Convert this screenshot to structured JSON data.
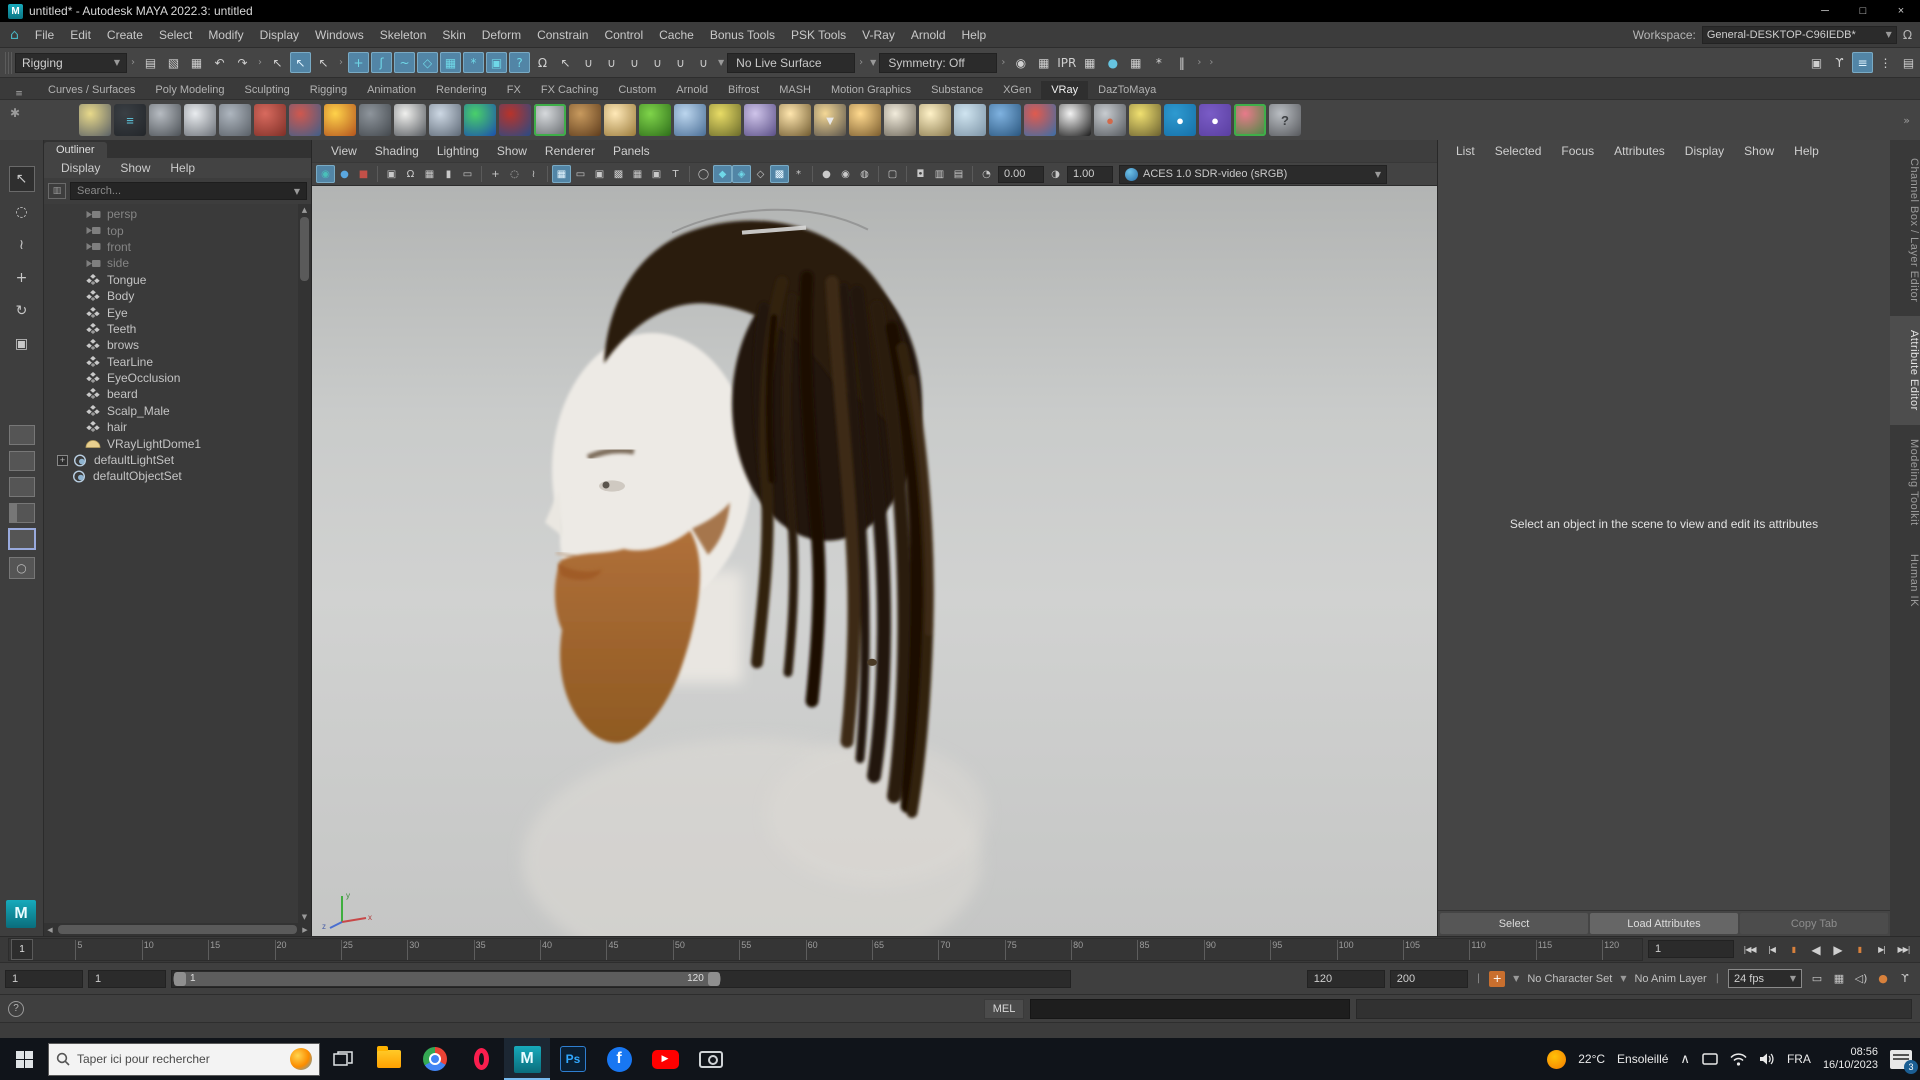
{
  "titlebar": {
    "title": "untitled* - Autodesk MAYA 2022.3: untitled",
    "minimize": "─",
    "maximize": "□",
    "close": "×"
  },
  "menubar": {
    "items": [
      "File",
      "Edit",
      "Create",
      "Select",
      "Modify",
      "Display",
      "Windows",
      "Skeleton",
      "Skin",
      "Deform",
      "Constrain",
      "Control",
      "Cache",
      "Bonus Tools",
      "PSK Tools",
      "V-Ray",
      "Arnold",
      "Help"
    ],
    "workspace_label": "Workspace:",
    "workspace_value": "General-DESKTOP-C96IEDB*"
  },
  "statusline": {
    "mode": "Rigging",
    "live_surface": "No Live Surface",
    "symmetry": "Symmetry: Off",
    "file_icons": [
      {
        "n": "new-scene",
        "g": "▤"
      },
      {
        "n": "open-scene",
        "g": "▧"
      },
      {
        "n": "save-scene",
        "g": "▦"
      },
      {
        "n": "undo",
        "g": "↶"
      },
      {
        "n": "redo",
        "g": "↷"
      }
    ],
    "select_icons": [
      {
        "n": "select-by-hierarchy",
        "g": "↖"
      },
      {
        "n": "select-by-object",
        "g": "↖",
        "a": true
      },
      {
        "n": "select-by-component",
        "g": "↖"
      }
    ],
    "mask_icons": [
      {
        "n": "select-handles",
        "g": "+",
        "a": true
      },
      {
        "n": "select-joints",
        "g": "ʃ",
        "a": true
      },
      {
        "n": "select-curves",
        "g": "~",
        "a": true
      },
      {
        "n": "select-surfaces",
        "g": "◇",
        "a": true
      },
      {
        "n": "select-deformers",
        "g": "▦",
        "a": true
      },
      {
        "n": "select-dynamics",
        "g": "*",
        "a": true
      },
      {
        "n": "select-rendering",
        "g": "▣",
        "a": true
      },
      {
        "n": "select-misc",
        "g": "?",
        "a": true
      }
    ],
    "lock_icons": [
      {
        "n": "lock-selection",
        "g": "Ω"
      },
      {
        "n": "highlight-selection",
        "g": "↖"
      }
    ],
    "snap_icons": [
      {
        "n": "snap-to-grids",
        "g": "∪"
      },
      {
        "n": "snap-to-curves",
        "g": "∪"
      },
      {
        "n": "snap-to-points",
        "g": "∪"
      },
      {
        "n": "snap-to-projected-center",
        "g": "∪"
      },
      {
        "n": "snap-to-view-planes",
        "g": "∪"
      },
      {
        "n": "make-object-live",
        "g": "∪"
      }
    ],
    "render_icons": [
      {
        "n": "open-render-view",
        "g": "◉"
      },
      {
        "n": "render-current-frame",
        "g": "▦"
      },
      {
        "n": "ipr-render",
        "g": "IPR"
      },
      {
        "n": "render-settings",
        "g": "▦"
      },
      {
        "n": "hypershade",
        "g": "●",
        "c": "#66c4e0"
      },
      {
        "n": "render-setup",
        "g": "▦"
      },
      {
        "n": "light-editor",
        "g": "*"
      },
      {
        "n": "pause-viewport",
        "g": "‖"
      }
    ],
    "right_icons": [
      {
        "n": "modeling-toolkit",
        "g": "▣"
      },
      {
        "n": "human-ik",
        "g": "ϒ"
      },
      {
        "n": "attribute-editor",
        "g": "≡",
        "a": true
      },
      {
        "n": "tool-settings",
        "g": "⋮"
      },
      {
        "n": "channel-box",
        "g": "▤"
      }
    ]
  },
  "shelf": {
    "tabs": [
      "Curves / Surfaces",
      "Poly Modeling",
      "Sculpting",
      "Rigging",
      "Animation",
      "Rendering",
      "FX",
      "FX Caching",
      "Custom",
      "Arnold",
      "Bifrost",
      "MASH",
      "Motion Graphics",
      "Substance",
      "XGen",
      "VRay",
      "DazToMaya"
    ],
    "active_tab": "VRay",
    "overflow": "»",
    "icons": [
      {
        "n": "vray-proxy-export",
        "b1": "#cfd4d9",
        "b2": "#4d5archive256"
      },
      {
        "n": "vray-proxy-import",
        "b1": "#e8d98a",
        "b2": "#5a6066"
      },
      {
        "n": "vray-scene-manager",
        "b1": "#3a3f44",
        "b2": "#23262a",
        "g": "≡",
        "gc": "#5ec8e0"
      },
      {
        "n": "vray-plugin",
        "b1": "#b7bcc2",
        "b2": "#4c5156"
      },
      {
        "n": "vray-notes",
        "b1": "#e9ecef",
        "b2": "#6b7077"
      },
      {
        "n": "vray-blend-material",
        "b1": "#aeb6bf",
        "b2": "#595f66"
      },
      {
        "n": "vray-physical-camera",
        "b1": "#d86a5e",
        "b2": "#7e2f27"
      },
      {
        "n": "vray-displacement",
        "b1": "#d0584e",
        "b2": "#3e5f8a"
      },
      {
        "n": "vray-fire",
        "b1": "#ffd24a",
        "b2": "#b3541e"
      },
      {
        "n": "vray-volume-grid",
        "b1": "#8e959c",
        "b2": "#43484d"
      },
      {
        "n": "vray-paper",
        "b1": "#f0f0ee",
        "b2": "#55595e"
      },
      {
        "n": "vray-cone-sphere",
        "b1": "#cdd8e4",
        "b2": "#5d6875"
      },
      {
        "n": "vray-heatmap",
        "b1": "#49d06a",
        "b2": "#1c4fae"
      },
      {
        "n": "vray-earth",
        "b1": "#b8332a",
        "b2": "#274b86"
      },
      {
        "n": "vray-sphere-selected",
        "b1": "#d6d9dc",
        "b2": "#62666a",
        "frame": "#3fae49"
      },
      {
        "n": "vray-wood-texture",
        "b1": "#c89a5e",
        "b2": "#5e3c1c"
      },
      {
        "n": "vray-glow-sphere",
        "b1": "#ffe9b8",
        "b2": "#9a7a3a"
      },
      {
        "n": "vray-grass",
        "b1": "#7fd44a",
        "b2": "#2e6e1a"
      },
      {
        "n": "vray-flakes",
        "b1": "#bcd6ee",
        "b2": "#4a6e96"
      },
      {
        "n": "vray-curve-tool",
        "b1": "#e8dc66",
        "b2": "#6a6a2a"
      },
      {
        "n": "vray-sphere-light-purple",
        "b1": "#cfc4ea",
        "b2": "#5a4f86"
      },
      {
        "n": "vray-dome-light",
        "b1": "#ffe6ae",
        "b2": "#6f5a30"
      },
      {
        "n": "vray-rect-light",
        "b1": "#f4d896",
        "b2": "#58524a",
        "g": "▼",
        "gc": "#e8e8e8"
      },
      {
        "n": "vray-sphere-light",
        "b1": "#ffd98e",
        "b2": "#7a5c2e"
      },
      {
        "n": "vray-spot-light",
        "b1": "#f2ecdc",
        "b2": "#6c665a"
      },
      {
        "n": "vray-sun-light",
        "b1": "#fff2c8",
        "b2": "#8a7a4e"
      },
      {
        "n": "vray-plane",
        "b1": "#cfe4f0",
        "b2": "#7d94a6"
      },
      {
        "n": "vray-material-sphere",
        "b1": "#7fb2e0",
        "b2": "#2a567e"
      },
      {
        "n": "vray-multi-material",
        "b1": "#e05a4e",
        "b2": "#3a6ea8"
      },
      {
        "n": "vray-checker",
        "b1": "#f2f2f2",
        "b2": "#1a1a1a"
      },
      {
        "n": "vray-frame-buffer",
        "b1": "#c8ccd0",
        "b2": "#55595e",
        "g": "●",
        "gc": "#d2694a"
      },
      {
        "n": "vray-light-lister",
        "b1": "#f0e070",
        "b2": "#6a6030"
      },
      {
        "n": "vray-cloud",
        "b1": "#2e9ad0",
        "b2": "#1670a8",
        "g": "●",
        "gc": "#ffffff"
      },
      {
        "n": "vray-color-palette",
        "b1": "#7a5cc6",
        "b2": "#5a3fa0",
        "g": "●",
        "gc": "#ffffff"
      },
      {
        "n": "vray-balloons",
        "b1": "#e87a8a",
        "b2": "#3f8a3f",
        "frame": "#3fae49"
      },
      {
        "n": "vray-help",
        "b1": "#b9bdc2",
        "b2": "#56585c",
        "g": "?",
        "gc": "#3e4144"
      }
    ]
  },
  "toolbox": {
    "tools": [
      {
        "n": "select-tool",
        "g": "↖",
        "a": true
      },
      {
        "n": "lasso-tool",
        "g": "◌"
      },
      {
        "n": "paint-select-tool",
        "g": "≀"
      },
      {
        "n": "move-tool",
        "g": "+"
      },
      {
        "n": "rotate-tool",
        "g": "↻"
      },
      {
        "n": "scale-tool",
        "g": "▣"
      }
    ],
    "layouts": [
      {
        "n": "layout-single",
        "v": "a"
      },
      {
        "n": "layout-two-panes",
        "v": "b"
      },
      {
        "n": "layout-four-view",
        "v": "c"
      },
      {
        "n": "layout-outliner-persp",
        "v": "d"
      },
      {
        "n": "layout-persp-graph",
        "v": "b",
        "a": true
      }
    ],
    "magnifier": {
      "n": "zoom-layout",
      "g": "○"
    }
  },
  "outliner": {
    "title": "Outliner",
    "menus": [
      "Display",
      "Show",
      "Help"
    ],
    "search_placeholder": "Search...",
    "items": [
      {
        "label": "persp",
        "icon": "camera",
        "muted": true
      },
      {
        "label": "top",
        "icon": "camera",
        "muted": true
      },
      {
        "label": "front",
        "icon": "camera",
        "muted": true
      },
      {
        "label": "side",
        "icon": "camera",
        "muted": true
      },
      {
        "label": "Tongue",
        "icon": "mesh"
      },
      {
        "label": "Body",
        "icon": "mesh"
      },
      {
        "label": "Eye",
        "icon": "mesh"
      },
      {
        "label": "Teeth",
        "icon": "mesh"
      },
      {
        "label": "brows",
        "icon": "mesh"
      },
      {
        "label": "TearLine",
        "icon": "mesh"
      },
      {
        "label": "EyeOcclusion",
        "icon": "mesh"
      },
      {
        "label": "beard",
        "icon": "mesh"
      },
      {
        "label": "Scalp_Male",
        "icon": "mesh"
      },
      {
        "label": "hair",
        "icon": "mesh"
      },
      {
        "label": "VRayLightDome1",
        "icon": "dome-light"
      },
      {
        "label": "defaultLightSet",
        "icon": "set",
        "expandable": true
      },
      {
        "label": "defaultObjectSet",
        "icon": "set"
      }
    ]
  },
  "viewport": {
    "menus": [
      "View",
      "Shading",
      "Lighting",
      "Show",
      "Renderer",
      "Panels"
    ],
    "toolbar_icons": [
      {
        "n": "vray-vfb-toggle",
        "g": "◉",
        "a": true,
        "c": "#49c0b9"
      },
      {
        "n": "vray-ipr-start",
        "g": "●",
        "c": "#5aa7e0"
      },
      {
        "n": "vray-ipr-stop",
        "g": "■",
        "c": "#c25048"
      },
      {
        "d": 1
      },
      {
        "n": "select-camera",
        "g": "▣"
      },
      {
        "n": "lock-camera",
        "g": "Ω"
      },
      {
        "n": "camera-attributes",
        "g": "▦"
      },
      {
        "n": "bookmark-view",
        "g": "▮"
      },
      {
        "n": "image-plane",
        "g": "▭"
      },
      {
        "d": 1
      },
      {
        "n": "2d-pan-zoom",
        "g": "+"
      },
      {
        "n": "pick-matte",
        "g": "◌"
      },
      {
        "n": "greasepencil",
        "g": "≀"
      },
      {
        "d": 1
      },
      {
        "n": "grid-toggle",
        "g": "▦",
        "a": true
      },
      {
        "n": "film-gate",
        "g": "▭"
      },
      {
        "n": "resolution-gate",
        "g": "▣"
      },
      {
        "n": "gate-mask",
        "g": "▩"
      },
      {
        "n": "field-chart",
        "g": "▦"
      },
      {
        "n": "safe-action",
        "g": "▣"
      },
      {
        "n": "safe-title",
        "g": "T"
      },
      {
        "d": 1
      },
      {
        "n": "wireframe",
        "g": "◯"
      },
      {
        "n": "smooth-shade",
        "g": "◆",
        "a": true,
        "c": "#6fd8e8"
      },
      {
        "n": "textured",
        "g": "◈",
        "a": true,
        "c": "#6fd8e8"
      },
      {
        "n": "wire-on-shaded",
        "g": "◇"
      },
      {
        "n": "xray",
        "g": "▩",
        "a": true
      },
      {
        "n": "lighting-all",
        "g": "*"
      },
      {
        "d": 1
      },
      {
        "n": "shadows",
        "g": "●"
      },
      {
        "n": "ambient-occlusion",
        "g": "◉"
      },
      {
        "n": "anti-alias",
        "g": "◍"
      },
      {
        "d": 1
      },
      {
        "n": "isolate-select",
        "g": "▢"
      },
      {
        "d": 1
      },
      {
        "n": "screen-space-effects",
        "g": "◘"
      },
      {
        "n": "viewport-renderer",
        "g": "▥"
      },
      {
        "n": "clip-plane",
        "g": "▤"
      }
    ],
    "exposure_label": "0.00",
    "gamma_label": "1.00",
    "exposure_icon": "◔",
    "gamma_icon": "◑",
    "view_transform": "ACES 1.0 SDR-video (sRGB)"
  },
  "attribute_editor": {
    "menus": [
      "List",
      "Selected",
      "Focus",
      "Attributes",
      "Display",
      "Show",
      "Help"
    ],
    "message": "Select an object in the scene to view and edit its attributes",
    "buttons": [
      {
        "label": "Select"
      },
      {
        "label": "Load Attributes",
        "primary": true
      },
      {
        "label": "Copy Tab",
        "disabled": true
      }
    ]
  },
  "side_tabs": [
    {
      "label": "Channel Box / Layer Editor"
    },
    {
      "label": "Attribute Editor",
      "active": true
    },
    {
      "label": "Modeling Toolkit"
    },
    {
      "label": "Human IK"
    }
  ],
  "timeline": {
    "ticks": [
      "5",
      "10",
      "15",
      "20",
      "25",
      "30",
      "35",
      "40",
      "45",
      "50",
      "55",
      "60",
      "65",
      "70",
      "75",
      "80",
      "85",
      "90",
      "95",
      "100",
      "105",
      "110",
      "115",
      "120"
    ],
    "current_frame": "1",
    "current_field": "1",
    "transport": [
      {
        "n": "go-to-start",
        "g": "|◀◀"
      },
      {
        "n": "step-back-key",
        "g": "|◀"
      },
      {
        "n": "step-back-frame",
        "g": "▮",
        "o": true
      },
      {
        "n": "play-backwards",
        "g": "◀",
        "big": true
      },
      {
        "n": "play-forwards",
        "g": "▶",
        "big": true
      },
      {
        "n": "step-forward-frame",
        "g": "▮",
        "o": true
      },
      {
        "n": "step-forward-key",
        "g": "▶|"
      },
      {
        "n": "go-to-end",
        "g": "▶▶|"
      }
    ]
  },
  "range_slider": {
    "anim_start": "1",
    "playback_start": "1",
    "handle_start": "1",
    "handle_end": "120",
    "playback_end": "120",
    "anim_end": "200",
    "character_set": "No Character Set",
    "anim_layer": "No Anim Layer",
    "fps": "24 fps",
    "icons": [
      {
        "n": "script-output",
        "g": "▭"
      },
      {
        "n": "playblast",
        "g": "▦"
      },
      {
        "n": "mute-audio",
        "g": "◁)"
      },
      {
        "n": "auto-keyframe",
        "g": "●",
        "o": true
      },
      {
        "n": "animation-preferences",
        "g": "ϒ"
      }
    ]
  },
  "command_line": {
    "mel_label": "MEL"
  },
  "taskbar": {
    "search_placeholder": "Taper ici pour rechercher",
    "apps": [
      {
        "n": "task-view"
      },
      {
        "n": "file-explorer"
      },
      {
        "n": "chrome"
      },
      {
        "n": "opera"
      },
      {
        "n": "maya",
        "label": "M",
        "active": true
      },
      {
        "n": "photoshop",
        "label": "Ps"
      },
      {
        "n": "facebook",
        "label": "f"
      },
      {
        "n": "youtube",
        "label": "▶"
      },
      {
        "n": "capture-tool"
      }
    ],
    "tray": {
      "temp": "22°C",
      "weather": "Ensoleillé",
      "chevron": "∧",
      "lang": "FRA",
      "time": "08:56",
      "date": "16/10/2023",
      "badge": "3"
    }
  }
}
